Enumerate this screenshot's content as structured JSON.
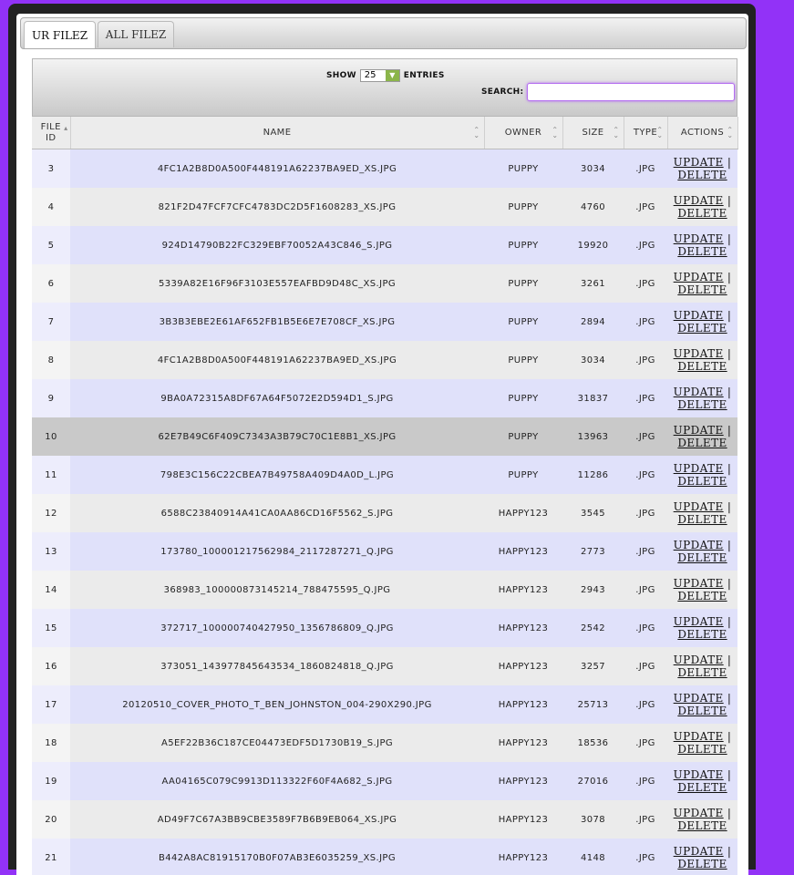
{
  "tabs": [
    {
      "label": "UR FILEZ",
      "active": true
    },
    {
      "label": "ALL FILEZ",
      "active": false
    }
  ],
  "filter": {
    "show_label": "SHOW",
    "entries_value": "25",
    "entries_label": "ENTRIES",
    "search_label": "SEARCH:",
    "search_value": ""
  },
  "columns": [
    "FILE ID",
    "NAME",
    "OWNER",
    "SIZE",
    "TYPE",
    "ACTIONS"
  ],
  "action_labels": {
    "update": "UPDATE",
    "sep": "|",
    "delete": "DELETE"
  },
  "highlighted_id": "10",
  "rows": [
    {
      "id": "3",
      "name": "4FC1A2B8D0A500F448191A62237BA9ED_XS.JPG",
      "owner": "PUPPY",
      "size": "3034",
      "type": ".JPG"
    },
    {
      "id": "4",
      "name": "821F2D47FCF7CFC4783DC2D5F1608283_XS.JPG",
      "owner": "PUPPY",
      "size": "4760",
      "type": ".JPG"
    },
    {
      "id": "5",
      "name": "924D14790B22FC329EBF70052A43C846_S.JPG",
      "owner": "PUPPY",
      "size": "19920",
      "type": ".JPG"
    },
    {
      "id": "6",
      "name": "5339A82E16F96F3103E557EAFBD9D48C_XS.JPG",
      "owner": "PUPPY",
      "size": "3261",
      "type": ".JPG"
    },
    {
      "id": "7",
      "name": "3B3B3EBE2E61AF652FB1B5E6E7E708CF_XS.JPG",
      "owner": "PUPPY",
      "size": "2894",
      "type": ".JPG"
    },
    {
      "id": "8",
      "name": "4FC1A2B8D0A500F448191A62237BA9ED_XS.JPG",
      "owner": "PUPPY",
      "size": "3034",
      "type": ".JPG"
    },
    {
      "id": "9",
      "name": "9BA0A72315A8DF67A64F5072E2D594D1_S.JPG",
      "owner": "PUPPY",
      "size": "31837",
      "type": ".JPG"
    },
    {
      "id": "10",
      "name": "62E7B49C6F409C7343A3B79C70C1E8B1_XS.JPG",
      "owner": "PUPPY",
      "size": "13963",
      "type": ".JPG"
    },
    {
      "id": "11",
      "name": "798E3C156C22CBEA7B49758A409D4A0D_L.JPG",
      "owner": "PUPPY",
      "size": "11286",
      "type": ".JPG"
    },
    {
      "id": "12",
      "name": "6588C23840914A41CA0AA86CD16F5562_S.JPG",
      "owner": "HAPPY123",
      "size": "3545",
      "type": ".JPG"
    },
    {
      "id": "13",
      "name": "173780_100001217562984_2117287271_Q.JPG",
      "owner": "HAPPY123",
      "size": "2773",
      "type": ".JPG"
    },
    {
      "id": "14",
      "name": "368983_100000873145214_788475595_Q.JPG",
      "owner": "HAPPY123",
      "size": "2943",
      "type": ".JPG"
    },
    {
      "id": "15",
      "name": "372717_100000740427950_1356786809_Q.JPG",
      "owner": "HAPPY123",
      "size": "2542",
      "type": ".JPG"
    },
    {
      "id": "16",
      "name": "373051_143977845643534_1860824818_Q.JPG",
      "owner": "HAPPY123",
      "size": "3257",
      "type": ".JPG"
    },
    {
      "id": "17",
      "name": "20120510_COVER_PHOTO_T_BEN_JOHNSTON_004-290X290.JPG",
      "owner": "HAPPY123",
      "size": "25713",
      "type": ".JPG"
    },
    {
      "id": "18",
      "name": "A5EF22B36C187CE04473EDF5D1730B19_S.JPG",
      "owner": "HAPPY123",
      "size": "18536",
      "type": ".JPG"
    },
    {
      "id": "19",
      "name": "AA04165C079C9913D113322F60F4A682_S.JPG",
      "owner": "HAPPY123",
      "size": "27016",
      "type": ".JPG"
    },
    {
      "id": "20",
      "name": "AD49F7C67A3BB9CBE3589F7B6B9EB064_XS.JPG",
      "owner": "HAPPY123",
      "size": "3078",
      "type": ".JPG"
    },
    {
      "id": "21",
      "name": "B442A8AC81915170B0F07AB3E6035259_XS.JPG",
      "owner": "HAPPY123",
      "size": "4148",
      "type": ".JPG"
    }
  ]
}
